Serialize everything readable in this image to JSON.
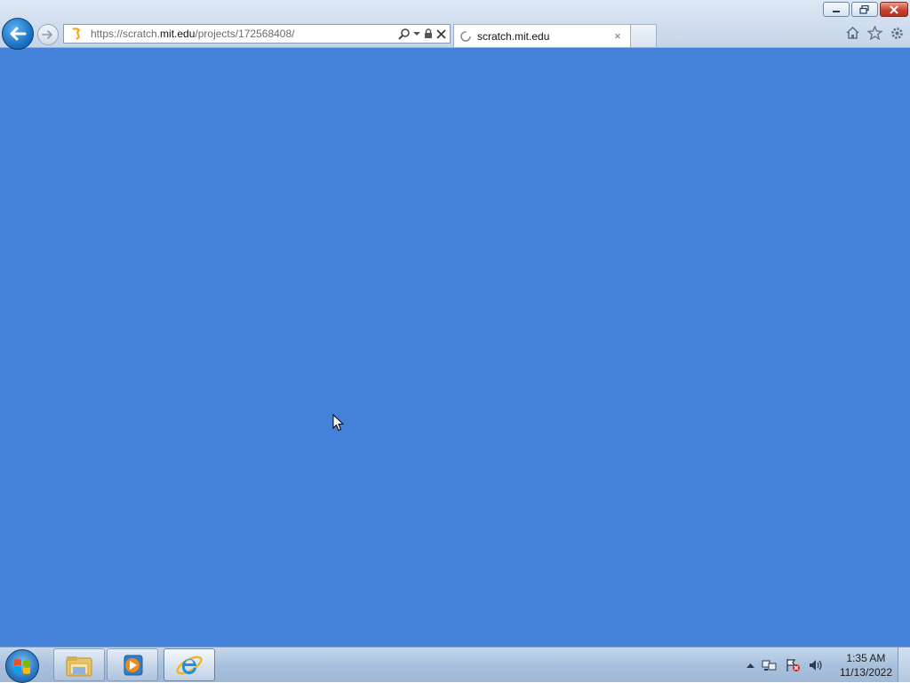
{
  "browser": {
    "address": {
      "scheme": "https://scratch.",
      "host": "mit.edu",
      "path": "/projects/172568408/"
    },
    "tab": {
      "title": "scratch.mit.edu",
      "close_glyph": "×"
    },
    "icons": {
      "back": "back-arrow-icon",
      "forward": "forward-arrow-icon",
      "search": "search-icon",
      "lock": "lock-icon",
      "stop": "stop-icon",
      "home": "home-icon",
      "favorites": "favorites-star-icon",
      "tools": "gear-icon"
    }
  },
  "page": {
    "background_color": "#4481d9"
  },
  "taskbar": {
    "buttons": [
      "start-orb",
      "windows-explorer",
      "windows-media-player",
      "internet-explorer"
    ],
    "clock": {
      "time": "1:35 AM",
      "date": "11/13/2022"
    },
    "tray_icons": [
      "show-hidden-icons",
      "network-icon",
      "action-center-flag-icon",
      "volume-icon"
    ]
  }
}
